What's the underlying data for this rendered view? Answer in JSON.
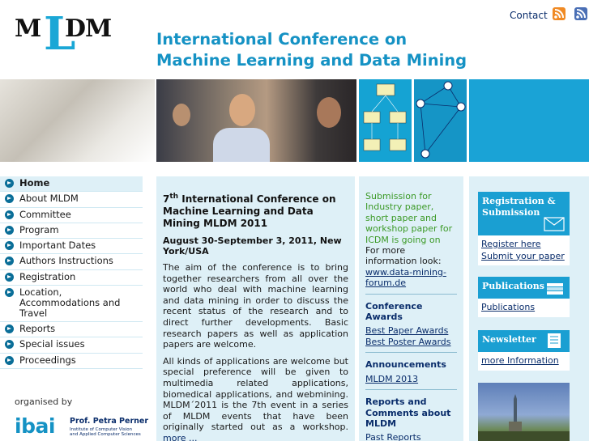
{
  "logo": {
    "m1": "M",
    "l": "L",
    "dm": "DM"
  },
  "header": {
    "contact": "Contact",
    "title_line1": "International Conference on",
    "title_line2": "Machine Learning and Data Mining"
  },
  "sidebar": {
    "items": [
      {
        "label": "Home"
      },
      {
        "label": "About MLDM"
      },
      {
        "label": "Committee"
      },
      {
        "label": "Program"
      },
      {
        "label": "Important Dates"
      },
      {
        "label": "Authors Instructions"
      },
      {
        "label": "Registration"
      },
      {
        "label": "Location, Accommodations and Travel"
      },
      {
        "label": "Reports"
      },
      {
        "label": "Special issues"
      },
      {
        "label": "Proceedings"
      }
    ],
    "organised_by": "organised by",
    "org_name": "ibai",
    "org_person": "Prof. Petra Perner",
    "org_sub1": "Institute of Computer Vision",
    "org_sub2": "and Applied Computer Sciences"
  },
  "main": {
    "title_num": "7",
    "title_sup": "th",
    "title_rest": " International Conference on Machine Learning and Data Mining MLDM 2011",
    "dates": "August 30-September 3, 2011, New York/USA",
    "p1": "The aim of the conference is to bring together researchers from all over the world who deal with machine learning and data mining in order to discuss the recent status of the research and to direct further developments. Basic research papers as well as application papers are welcome.",
    "p2": "All kinds of applications are welcome but special preference will be given to multimedia related applications, biomedical applications, and webmining. MLDM´2011 is the 7th event in a series of MLDM events that have been originally started out as a workshop. ",
    "more": "more ..."
  },
  "mid": {
    "green": "Submission for Industry paper, short paper and workshop paper for ICDM is going on",
    "info": "For more information look: ",
    "link": "www.data-mining-forum.de",
    "awards_h": "Conference Awards",
    "awards": [
      "Best Paper Awards",
      "Best Poster Awards"
    ],
    "ann_h": "Announcements",
    "ann": [
      "MLDM 2013"
    ],
    "rep_h": "Reports and Comments about MLDM",
    "rep": [
      "Past Reports"
    ]
  },
  "right": {
    "reg_h": "Registration & Submission",
    "reg_links": [
      "Register here",
      "Submit your paper"
    ],
    "pub_h": "Publications",
    "pub_link": "Publications",
    "news_h": "Newsletter",
    "news_link": "more Information"
  },
  "colors": {
    "accent": "#1aa3d6",
    "navy": "#0a2d6b",
    "panel_bg": "#def0f7",
    "green": "#3c9a27"
  }
}
